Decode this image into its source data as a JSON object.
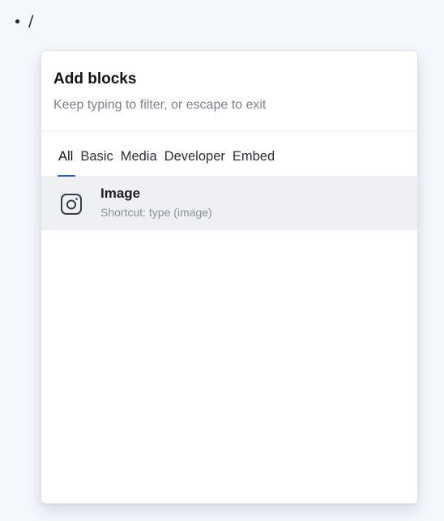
{
  "editor": {
    "bullet_text": "/"
  },
  "popover": {
    "title": "Add blocks",
    "subtitle": "Keep typing to filter, or escape to exit",
    "tabs": [
      {
        "label": "All",
        "active": true
      },
      {
        "label": "Basic",
        "active": false
      },
      {
        "label": "Media",
        "active": false
      },
      {
        "label": "Developer",
        "active": false
      },
      {
        "label": "Embed",
        "active": false
      }
    ],
    "results": [
      {
        "icon": "image-icon",
        "title": "Image",
        "shortcut": "Shortcut: type (image)"
      }
    ]
  },
  "colors": {
    "page_background": "#f4f7fc",
    "tab_active_underline": "#2b5fb4",
    "highlighted_row": "#eef0f3"
  }
}
